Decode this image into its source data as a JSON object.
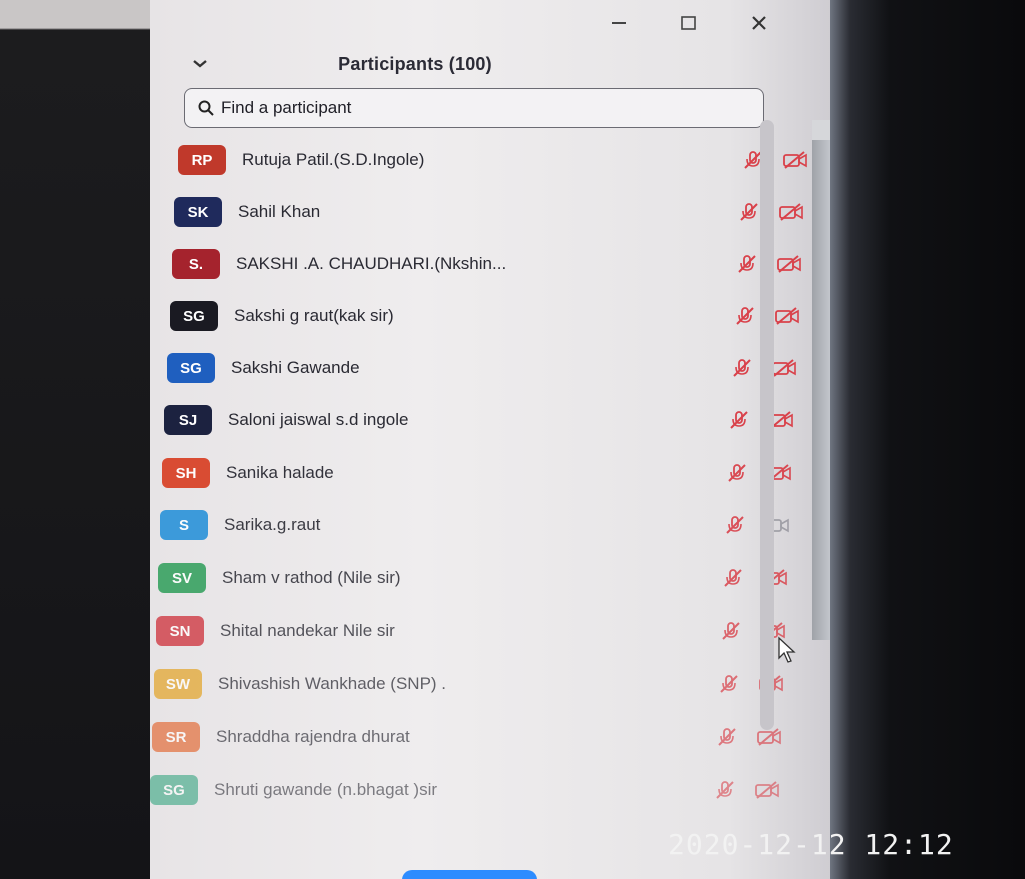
{
  "panel": {
    "title": "Participants (100)",
    "search_placeholder": "Find a participant"
  },
  "participants": [
    {
      "initials": "RP",
      "name": "Rutuja Patil.(S.D.Ingole)",
      "color": "#c0392b",
      "mic": "muted",
      "video": "off"
    },
    {
      "initials": "SK",
      "name": "Sahil Khan",
      "color": "#1f2a5c",
      "mic": "muted",
      "video": "off"
    },
    {
      "initials": "S.",
      "name": "SAKSHI .A. CHAUDHARI.(Nkshin...",
      "color": "#a5232d",
      "mic": "muted",
      "video": "off"
    },
    {
      "initials": "SG",
      "name": "Sakshi g raut(kak sir)",
      "color": "#1a1a22",
      "mic": "muted",
      "video": "off"
    },
    {
      "initials": "SG",
      "name": "Sakshi Gawande",
      "color": "#1f5fbf",
      "mic": "muted",
      "video": "off"
    },
    {
      "initials": "SJ",
      "name": "Saloni jaiswal s.d ingole",
      "color": "#1c2240",
      "mic": "muted",
      "video": "off"
    },
    {
      "initials": "SH",
      "name": "Sanika halade",
      "color": "#d9442a",
      "mic": "muted",
      "video": "off"
    },
    {
      "initials": "S",
      "name": "Sarika.g.raut",
      "color": "#2a92d9",
      "mic": "muted",
      "video": "on"
    },
    {
      "initials": "SV",
      "name": "Sham v rathod (Nile sir)",
      "color": "#2e9e5a",
      "mic": "muted",
      "video": "off"
    },
    {
      "initials": "SN",
      "name": "Shital nandekar Nile sir",
      "color": "#cf3640",
      "mic": "muted",
      "video": "off"
    },
    {
      "initials": "SW",
      "name": "Shivashish Wankhade (SNP) .",
      "color": "#e3a52a",
      "mic": "muted",
      "video": "off"
    },
    {
      "initials": "SR",
      "name": "Shraddha rajendra dhurat",
      "color": "#e3662f",
      "mic": "muted",
      "video": "off"
    },
    {
      "initials": "SG",
      "name": "Shruti gawande (n.bhagat )sir",
      "color": "#2fa37d",
      "mic": "muted",
      "video": "off"
    }
  ],
  "overlay": {
    "timestamp": "2020-12-12 12:12"
  }
}
